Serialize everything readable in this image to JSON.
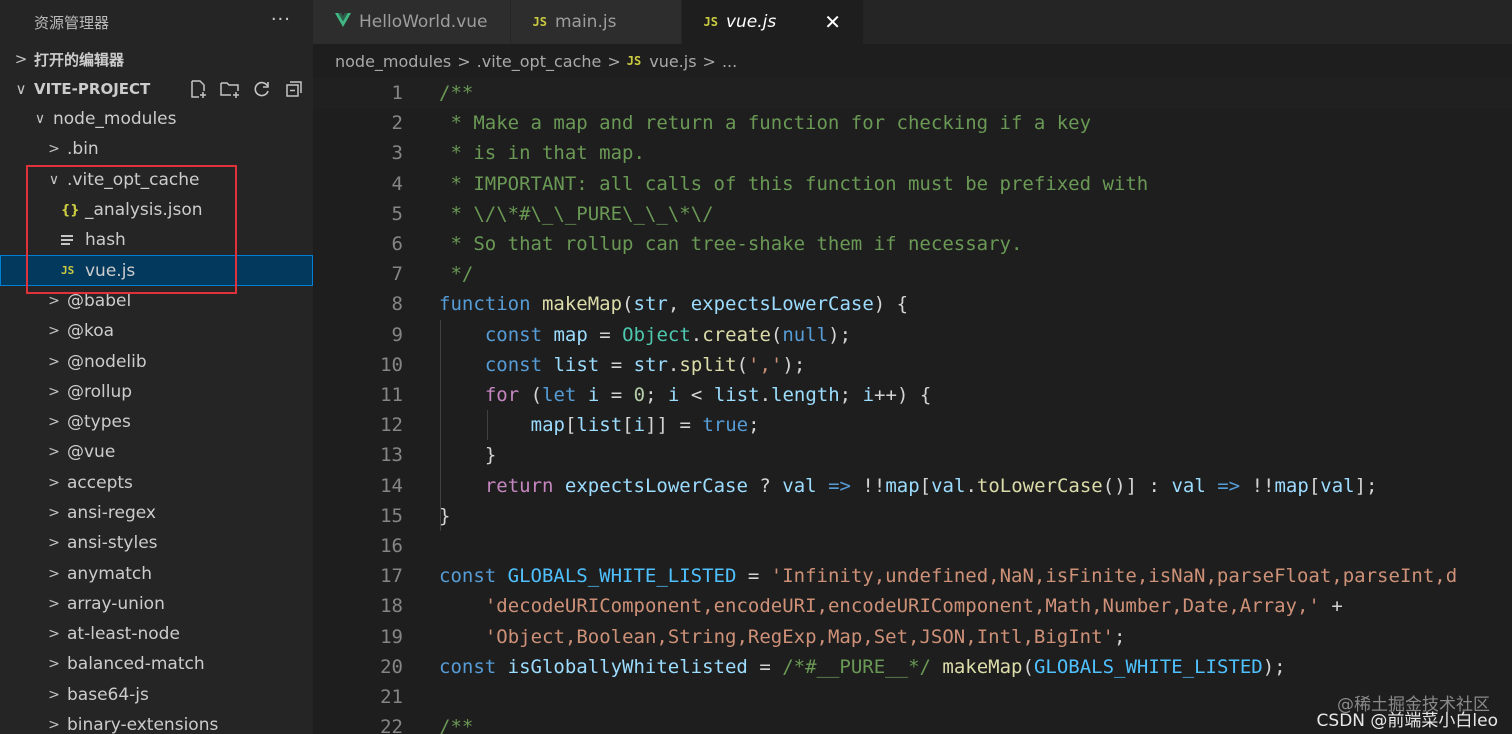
{
  "sidebar": {
    "title": "资源管理器",
    "more": "···",
    "open_editors": "打开的编辑器",
    "project": "VITE-PROJECT",
    "tree": [
      {
        "label": "node_modules",
        "chev": "∨",
        "icon": "none"
      },
      {
        "label": ".bin",
        "chev": ">",
        "icon": "none"
      },
      {
        "label": ".vite_opt_cache",
        "chev": "∨",
        "icon": "none"
      },
      {
        "label": "_analysis.json",
        "chev": "",
        "icon": "json"
      },
      {
        "label": "hash",
        "chev": "",
        "icon": "text"
      },
      {
        "label": "vue.js",
        "chev": "",
        "icon": "js"
      },
      {
        "label": "@babel",
        "chev": ">",
        "icon": "none"
      },
      {
        "label": "@koa",
        "chev": ">",
        "icon": "none"
      },
      {
        "label": "@nodelib",
        "chev": ">",
        "icon": "none"
      },
      {
        "label": "@rollup",
        "chev": ">",
        "icon": "none"
      },
      {
        "label": "@types",
        "chev": ">",
        "icon": "none"
      },
      {
        "label": "@vue",
        "chev": ">",
        "icon": "none"
      },
      {
        "label": "accepts",
        "chev": ">",
        "icon": "none"
      },
      {
        "label": "ansi-regex",
        "chev": ">",
        "icon": "none"
      },
      {
        "label": "ansi-styles",
        "chev": ">",
        "icon": "none"
      },
      {
        "label": "anymatch",
        "chev": ">",
        "icon": "none"
      },
      {
        "label": "array-union",
        "chev": ">",
        "icon": "none"
      },
      {
        "label": "at-least-node",
        "chev": ">",
        "icon": "none"
      },
      {
        "label": "balanced-match",
        "chev": ">",
        "icon": "none"
      },
      {
        "label": "base64-js",
        "chev": ">",
        "icon": "none"
      },
      {
        "label": "binary-extensions",
        "chev": ">",
        "icon": "none"
      }
    ],
    "selected_item": "vue.js"
  },
  "tabs": [
    {
      "label": "HelloWorld.vue",
      "icon": "vue-icon",
      "active": false
    },
    {
      "label": "main.js",
      "icon": "js-icon",
      "active": false
    },
    {
      "label": "vue.js",
      "icon": "js-icon",
      "active": true
    }
  ],
  "close_glyph": "✕",
  "breadcrumb": {
    "parts": [
      "node_modules",
      ".vite_opt_cache",
      "vue.js",
      "..."
    ],
    "sep": ">"
  },
  "js_badge": "JS",
  "json_badge": "{}",
  "editor": {
    "lines": [
      {
        "n": "1",
        "text": "/**"
      },
      {
        "n": "2",
        "text": " * Make a map and return a function for checking if a key"
      },
      {
        "n": "3",
        "text": " * is in that map."
      },
      {
        "n": "4",
        "text": " * IMPORTANT: all calls of this function must be prefixed with"
      },
      {
        "n": "5",
        "text": " * \\/\\*#\\_\\_PURE\\_\\_\\*\\/"
      },
      {
        "n": "6",
        "text": " * So that rollup can tree-shake them if necessary."
      },
      {
        "n": "7",
        "text": " */"
      },
      {
        "n": "8",
        "text": "function makeMap(str, expectsLowerCase) {"
      },
      {
        "n": "9",
        "text": "    const map = Object.create(null);"
      },
      {
        "n": "10",
        "text": "    const list = str.split(',');"
      },
      {
        "n": "11",
        "text": "    for (let i = 0; i < list.length; i++) {"
      },
      {
        "n": "12",
        "text": "        map[list[i]] = true;"
      },
      {
        "n": "13",
        "text": "    }"
      },
      {
        "n": "14",
        "text": "    return expectsLowerCase ? val => !!map[val.toLowerCase()] : val => !!map[val];"
      },
      {
        "n": "15",
        "text": "}"
      },
      {
        "n": "16",
        "text": ""
      },
      {
        "n": "17",
        "text": "const GLOBALS_WHITE_LISTED = 'Infinity,undefined,NaN,isFinite,isNaN,parseFloat,parseInt,d"
      },
      {
        "n": "18",
        "text": "    'decodeURIComponent,encodeURI,encodeURIComponent,Math,Number,Date,Array,' +"
      },
      {
        "n": "19",
        "text": "    'Object,Boolean,String,RegExp,Map,Set,JSON,Intl,BigInt';"
      },
      {
        "n": "20",
        "text": "const isGloballyWhitelisted = /*#__PURE__*/ makeMap(GLOBALS_WHITE_LISTED);"
      },
      {
        "n": "21",
        "text": ""
      },
      {
        "n": "22",
        "text": "/**"
      }
    ]
  },
  "watermark": {
    "line1": "@稀土掘金技术社区",
    "line2": "CSDN @前端菜小白leo"
  },
  "colors": {
    "comment": "#6a9955",
    "keyword": "#569cd6",
    "function": "#dcdcaa",
    "variable": "#9cdcfe",
    "string": "#ce9178",
    "control": "#c586c0",
    "type": "#4ec9b0",
    "constant": "#4fc1ff",
    "number": "#b5cea8",
    "highlight_box": "#e0323a"
  }
}
